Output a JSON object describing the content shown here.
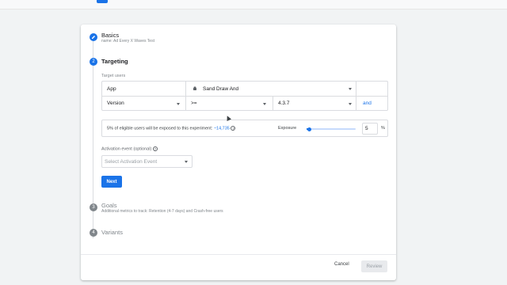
{
  "steps": [
    {
      "number": "1",
      "title": "Basics",
      "subtitle": "name: Ad Every X Waves Test",
      "state": "done"
    },
    {
      "number": "2",
      "title": "Targeting",
      "state": "active"
    },
    {
      "number": "3",
      "title": "Goals",
      "subtitle": "Additional metrics to track: Retention (4-7 days) and Crash-free users",
      "state": "pending"
    },
    {
      "number": "4",
      "title": "Variants",
      "state": "pending"
    }
  ],
  "targeting": {
    "section_label": "Target users",
    "row1": {
      "field": "App",
      "value": "Sand Draw And"
    },
    "row2": {
      "field": "Version",
      "operator": ">=",
      "value": "4.3.7",
      "link": "and"
    }
  },
  "exposure": {
    "message_prefix": "5% of eligible users will be exposed to this experiment:",
    "user_count": "~14,735",
    "label": "Exposure",
    "value": "5",
    "percent": 5,
    "unit": "%"
  },
  "activation": {
    "label": "Activation event (optional)",
    "placeholder": "Select Activation Event"
  },
  "buttons": {
    "next": "Next",
    "cancel": "Cancel",
    "review": "Review"
  },
  "colors": {
    "accent": "#1a73e8",
    "pending_step": "#80868b"
  },
  "icons": {
    "done_step": "pencil-icon",
    "app": "android-icon",
    "help": "help-circle-icon"
  }
}
